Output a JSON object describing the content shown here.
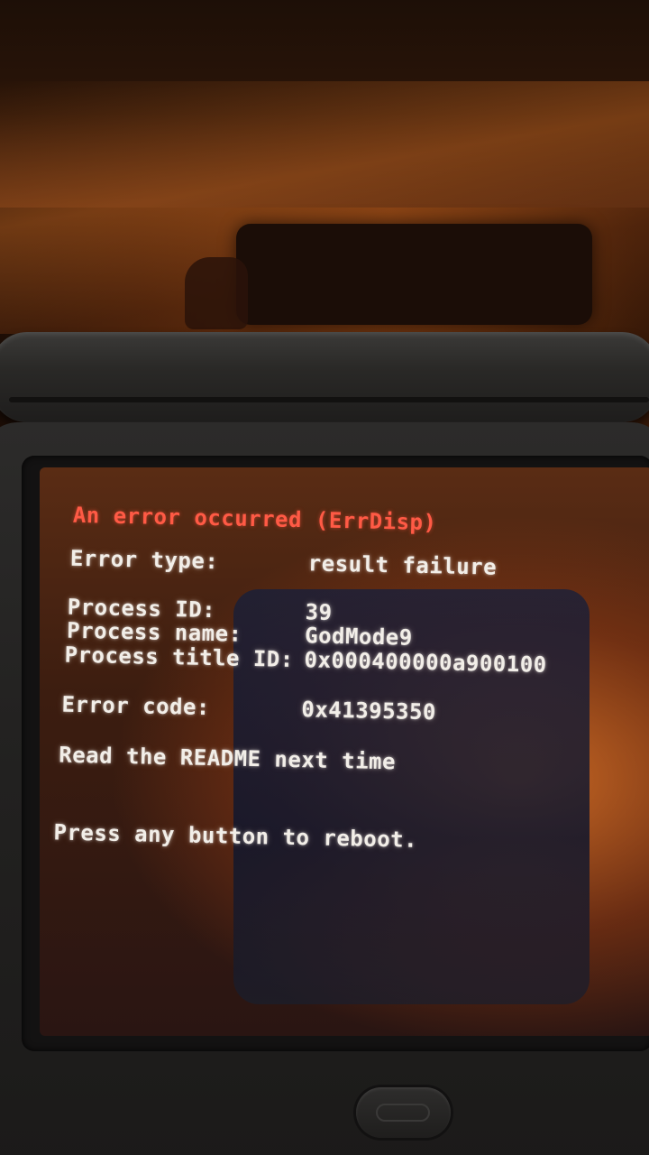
{
  "error_screen": {
    "title": "An error occurred (ErrDisp)",
    "error_type_label": "Error type:",
    "error_type_value": "result failure",
    "process_id_label": "Process ID:",
    "process_id_value": "39",
    "process_name_label": "Process name:",
    "process_name_value": "GodMode9",
    "process_title_id_label": "Process title ID:",
    "process_title_id_value": "0x000400000a900100",
    "error_code_label": "Error code:",
    "error_code_value": "0x41395350",
    "message": "Read the README next time",
    "prompt": "Press any button to reboot."
  },
  "colors": {
    "title_color": "#ff5a45",
    "text_color": "#f2eee8"
  }
}
